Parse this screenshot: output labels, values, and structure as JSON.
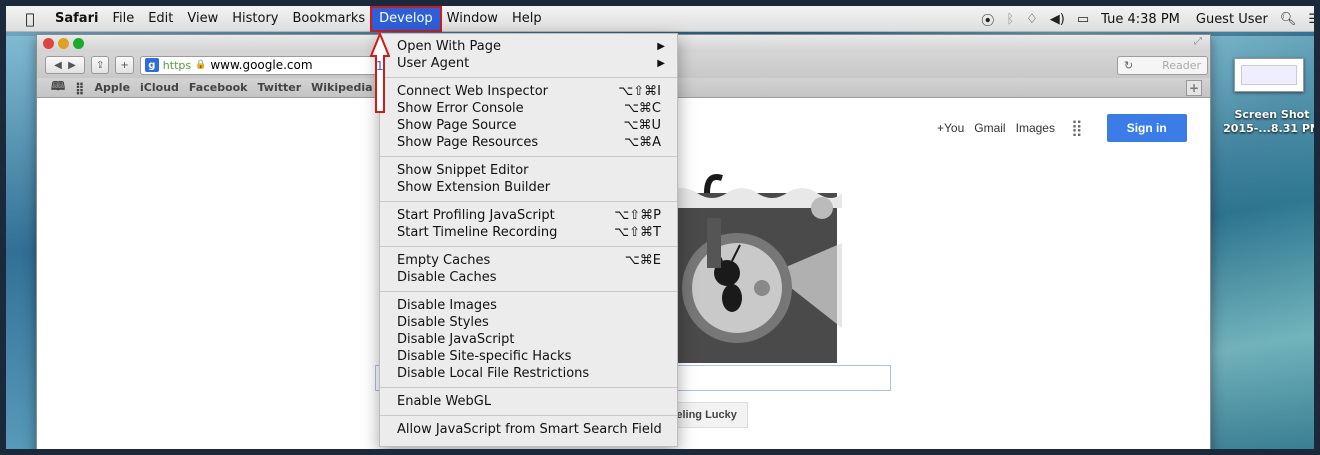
{
  "menubar": {
    "apple_icon": "apple-icon",
    "items": [
      "Safari",
      "File",
      "Edit",
      "View",
      "History",
      "Bookmarks",
      "Develop",
      "Window",
      "Help"
    ],
    "active": "Develop",
    "clock": "Tue 4:38 PM",
    "user": "Guest User",
    "status_icons": [
      "location-icon",
      "bluetooth-icon",
      "wifi-icon",
      "volume-icon",
      "battery-icon",
      "spotlight-icon",
      "notification-icon"
    ]
  },
  "browser": {
    "url_scheme": "https",
    "url": "www.google.com",
    "reader": "Reader",
    "bookmarks": [
      "Apple",
      "iCloud",
      "Facebook",
      "Twitter",
      "Wikipedia"
    ]
  },
  "google": {
    "you": "+You",
    "gmail": "Gmail",
    "images": "Images",
    "signin": "Sign in",
    "lucky": "I'm Feeling Lucky"
  },
  "develop_menu": {
    "callout_number": "1",
    "groups": [
      [
        {
          "label": "Open With Page",
          "submenu": true
        },
        {
          "label": "User Agent",
          "submenu": true
        }
      ],
      [
        {
          "label": "Connect Web Inspector",
          "shortcut": "⌥⇧⌘I"
        },
        {
          "label": "Show Error Console",
          "shortcut": "⌥⌘C"
        },
        {
          "label": "Show Page Source",
          "shortcut": "⌥⌘U"
        },
        {
          "label": "Show Page Resources",
          "shortcut": "⌥⌘A"
        }
      ],
      [
        {
          "label": "Show Snippet Editor"
        },
        {
          "label": "Show Extension Builder"
        }
      ],
      [
        {
          "label": "Start Profiling JavaScript",
          "shortcut": "⌥⇧⌘P"
        },
        {
          "label": "Start Timeline Recording",
          "shortcut": "⌥⇧⌘T"
        }
      ],
      [
        {
          "label": "Empty Caches",
          "shortcut": "⌥⌘E"
        },
        {
          "label": "Disable Caches"
        }
      ],
      [
        {
          "label": "Disable Images"
        },
        {
          "label": "Disable Styles"
        },
        {
          "label": "Disable JavaScript"
        },
        {
          "label": "Disable Site-specific Hacks"
        },
        {
          "label": "Disable Local File Restrictions"
        }
      ],
      [
        {
          "label": "Enable WebGL"
        }
      ],
      [
        {
          "label": "Allow JavaScript from Smart Search Field"
        }
      ]
    ]
  },
  "desktop": {
    "file_name_line1": "Screen Shot",
    "file_name_line2": "2015-...8.31 PM"
  },
  "colors": {
    "menu_highlight": "#2c5fd8",
    "callout_red": "#d01b1b",
    "signin_blue": "#3b7de8"
  }
}
